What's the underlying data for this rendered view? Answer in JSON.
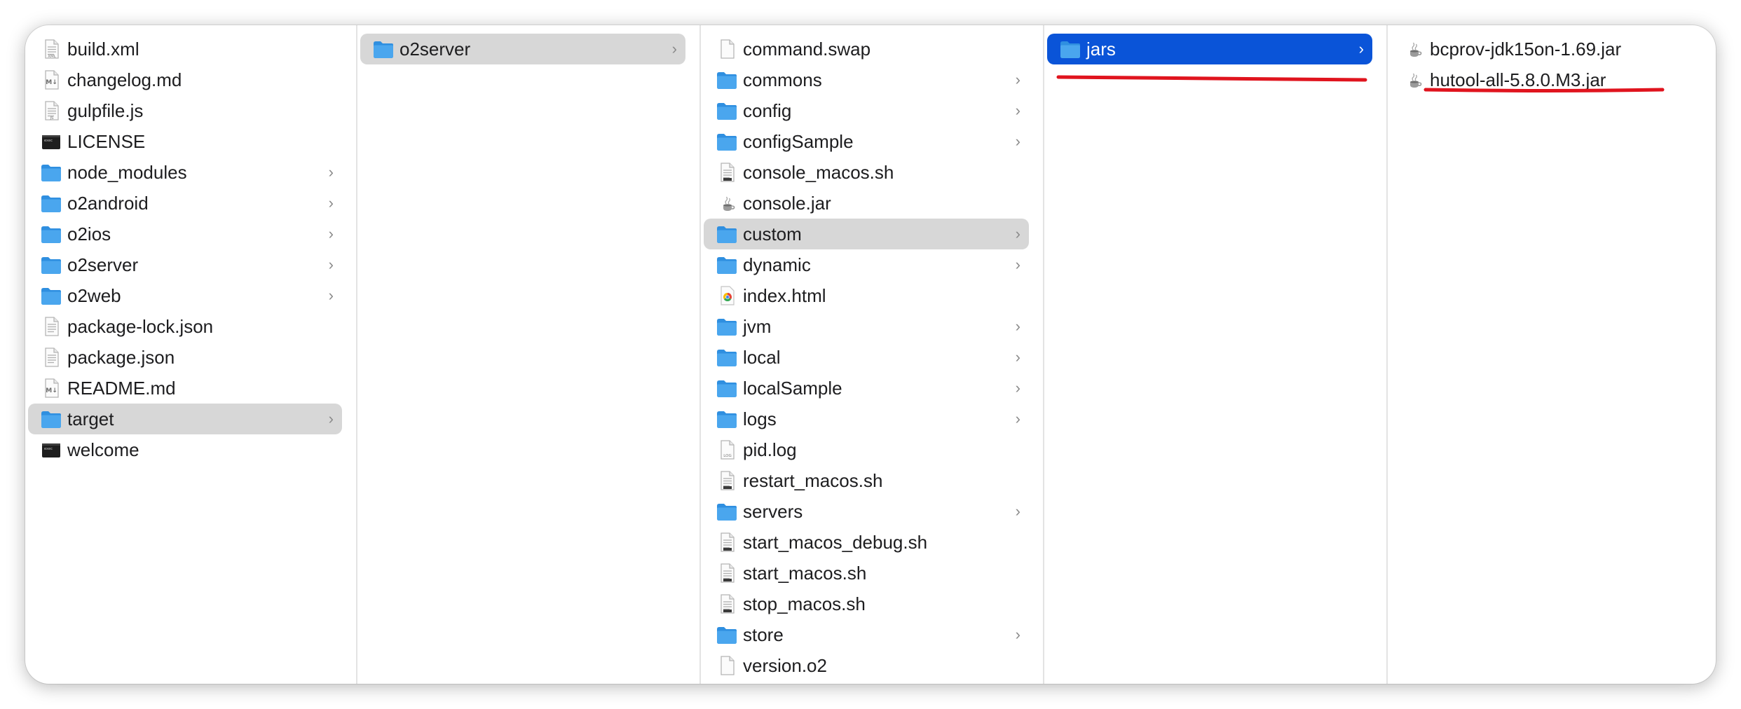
{
  "colors": {
    "folder": "#4aa6ee",
    "folder_dark": "#2f8fe0",
    "selection_inactive": "#d7d7d7",
    "selection_active": "#0a54d8",
    "annotation": "#e0141e"
  },
  "columns": [
    {
      "items": [
        {
          "name": "build.xml",
          "icon": "xml-file-icon"
        },
        {
          "name": "changelog.md",
          "icon": "markdown-file-icon"
        },
        {
          "name": "gulpfile.js",
          "icon": "js-file-icon"
        },
        {
          "name": "LICENSE",
          "icon": "terminal-file-icon"
        },
        {
          "name": "node_modules",
          "icon": "folder-icon",
          "chevron": true
        },
        {
          "name": "o2android",
          "icon": "folder-icon",
          "chevron": true
        },
        {
          "name": "o2ios",
          "icon": "folder-icon",
          "chevron": true
        },
        {
          "name": "o2server",
          "icon": "folder-icon",
          "chevron": true
        },
        {
          "name": "o2web",
          "icon": "folder-icon",
          "chevron": true
        },
        {
          "name": "package-lock.json",
          "icon": "json-file-icon"
        },
        {
          "name": "package.json",
          "icon": "json-file-icon"
        },
        {
          "name": "README.md",
          "icon": "markdown-file-icon"
        },
        {
          "name": "target",
          "icon": "folder-icon",
          "chevron": true,
          "selected": "inactive"
        },
        {
          "name": "welcome",
          "icon": "terminal-file-icon"
        }
      ]
    },
    {
      "items": [
        {
          "name": "o2server",
          "icon": "folder-icon",
          "chevron": true,
          "selected": "inactive"
        }
      ]
    },
    {
      "items": [
        {
          "name": "command.swap",
          "icon": "blank-file-icon"
        },
        {
          "name": "commons",
          "icon": "folder-icon",
          "chevron": true
        },
        {
          "name": "config",
          "icon": "folder-icon",
          "chevron": true
        },
        {
          "name": "configSample",
          "icon": "folder-icon",
          "chevron": true
        },
        {
          "name": "console_macos.sh",
          "icon": "shell-script-icon"
        },
        {
          "name": "console.jar",
          "icon": "java-jar-icon"
        },
        {
          "name": "custom",
          "icon": "folder-icon",
          "chevron": true,
          "selected": "inactive"
        },
        {
          "name": "dynamic",
          "icon": "folder-icon",
          "chevron": true
        },
        {
          "name": "index.html",
          "icon": "chrome-html-icon"
        },
        {
          "name": "jvm",
          "icon": "folder-icon",
          "chevron": true
        },
        {
          "name": "local",
          "icon": "folder-icon",
          "chevron": true
        },
        {
          "name": "localSample",
          "icon": "folder-icon",
          "chevron": true
        },
        {
          "name": "logs",
          "icon": "folder-icon",
          "chevron": true
        },
        {
          "name": "pid.log",
          "icon": "log-file-icon"
        },
        {
          "name": "restart_macos.sh",
          "icon": "shell-script-icon"
        },
        {
          "name": "servers",
          "icon": "folder-icon",
          "chevron": true
        },
        {
          "name": "start_macos_debug.sh",
          "icon": "shell-script-icon"
        },
        {
          "name": "start_macos.sh",
          "icon": "shell-script-icon"
        },
        {
          "name": "stop_macos.sh",
          "icon": "shell-script-icon"
        },
        {
          "name": "store",
          "icon": "folder-icon",
          "chevron": true
        },
        {
          "name": "version.o2",
          "icon": "blank-file-icon"
        }
      ]
    },
    {
      "items": [
        {
          "name": "jars",
          "icon": "folder-icon",
          "chevron": true,
          "selected": "active"
        }
      ]
    },
    {
      "items": [
        {
          "name": "bcprov-jdk15on-1.69.jar",
          "icon": "java-jar-icon"
        },
        {
          "name": "hutool-all-5.8.0.M3.jar",
          "icon": "java-jar-icon"
        }
      ]
    }
  ]
}
